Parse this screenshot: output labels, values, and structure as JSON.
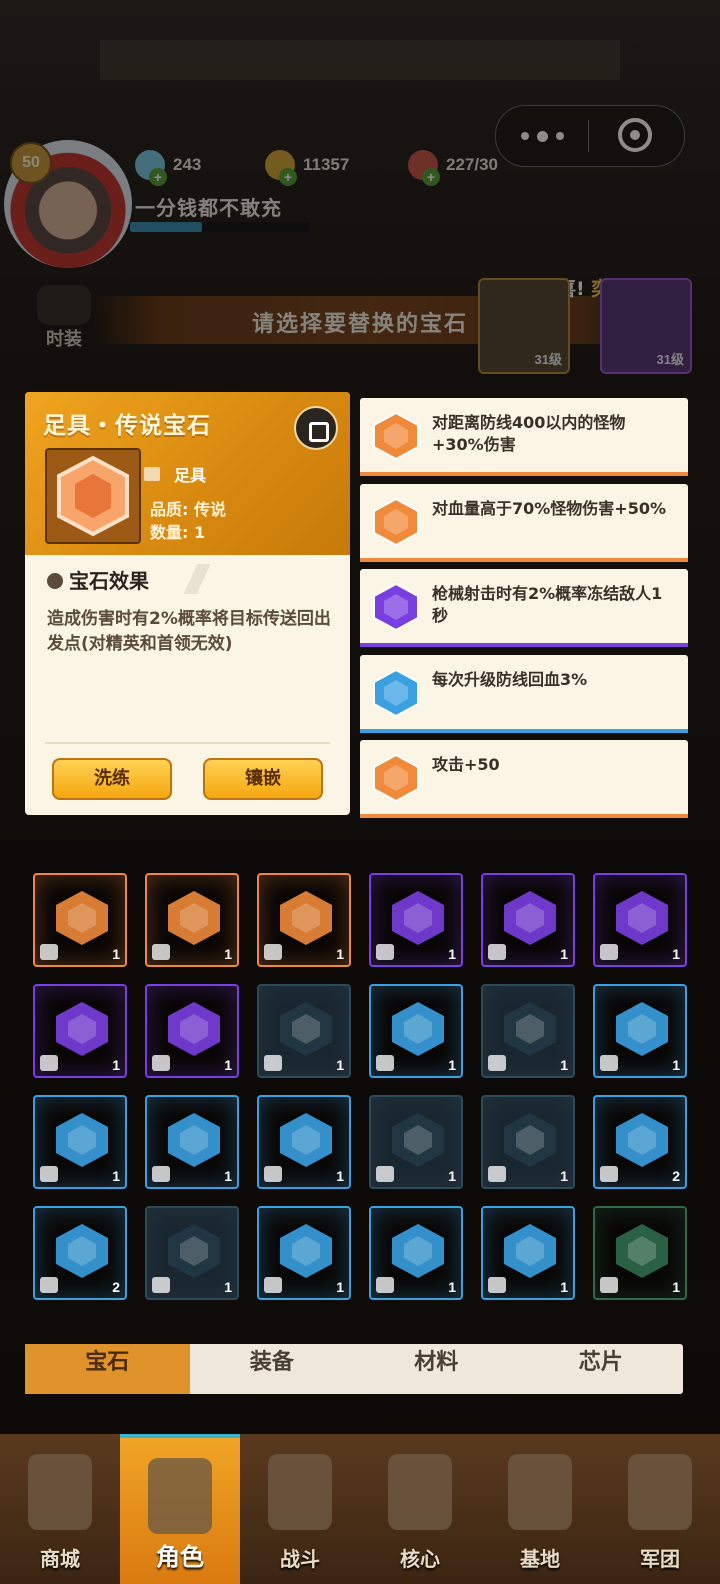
{
  "player": {
    "level": "50",
    "name": "一分钱都不敢充",
    "exp_fraction": 0.4
  },
  "resources": [
    {
      "icon": "diamond-icon",
      "value": "243",
      "color": "#7ec8e3"
    },
    {
      "icon": "gold-coin-icon",
      "value": "11357",
      "color": "#d4a83a"
    },
    {
      "icon": "meat-stamina-icon",
      "value": "227/30",
      "color": "#c9584b"
    }
  ],
  "side_menu": {
    "fashion_label": "时装"
  },
  "banner": {
    "title": "请选择要替换的宝石",
    "congrats": "恭喜!",
    "congrats_name": "奕"
  },
  "top_items": [
    {
      "level": "31级"
    },
    {
      "level": "31级"
    }
  ],
  "detail": {
    "title": "足具・传说宝石",
    "slot_label": "足具",
    "quality": "品质: 传说",
    "count": "数量: 1",
    "effect_heading": "宝石效果",
    "effect_text": "造成伤害时有2%概率将目标传送回出发点(对精英和首领无效)",
    "refine_button": "洗练",
    "inlay_button": "镶嵌"
  },
  "options": [
    {
      "text": "对距离防线400以内的怪物+30%伤害",
      "rarity": "orange"
    },
    {
      "text": "对血量高于70%怪物伤害+50%",
      "rarity": "orange"
    },
    {
      "text": "枪械射击时有2%概率冻结敌人1秒",
      "rarity": "purple"
    },
    {
      "text": "每次升级防线回血3%",
      "rarity": "blue"
    },
    {
      "text": "攻击+50",
      "rarity": "orange"
    }
  ],
  "colors": {
    "orange": "#f08a3a",
    "purple": "#7a3fe0",
    "blue": "#3aa0e0",
    "dark": "#2b4a5a",
    "green": "#2f6a4a"
  },
  "inventory": [
    {
      "rarity": "orange",
      "slot": "boots-icon",
      "count": "1"
    },
    {
      "rarity": "orange",
      "slot": "glove-icon",
      "count": "1"
    },
    {
      "rarity": "orange",
      "slot": "pants-icon",
      "count": "1"
    },
    {
      "rarity": "purple",
      "slot": "armor-icon",
      "count": "1"
    },
    {
      "rarity": "purple",
      "slot": "glove-icon",
      "count": "1"
    },
    {
      "rarity": "purple",
      "slot": "glove-icon",
      "count": "1"
    },
    {
      "rarity": "purple",
      "slot": "glove-icon",
      "count": "1"
    },
    {
      "rarity": "purple",
      "slot": "glove-icon",
      "count": "1"
    },
    {
      "rarity": "dark",
      "slot": "helmet-icon",
      "count": "1"
    },
    {
      "rarity": "blue",
      "slot": "armor-icon",
      "count": "1"
    },
    {
      "rarity": "dark",
      "slot": "armor-icon",
      "count": "1"
    },
    {
      "rarity": "blue",
      "slot": "armor-icon",
      "count": "1"
    },
    {
      "rarity": "blue",
      "slot": "armor-icon",
      "count": "1"
    },
    {
      "rarity": "blue",
      "slot": "boots-icon",
      "count": "1"
    },
    {
      "rarity": "blue",
      "slot": "boots-icon",
      "count": "1"
    },
    {
      "rarity": "dark",
      "slot": "glove-icon",
      "count": "1"
    },
    {
      "rarity": "dark",
      "slot": "glove-icon",
      "count": "1"
    },
    {
      "rarity": "blue",
      "slot": "pants-icon",
      "count": "2"
    },
    {
      "rarity": "blue",
      "slot": "pants-icon",
      "count": "2"
    },
    {
      "rarity": "dark",
      "slot": "glove-icon",
      "count": "1"
    },
    {
      "rarity": "blue",
      "slot": "glove-icon",
      "count": "1"
    },
    {
      "rarity": "blue",
      "slot": "glove-icon",
      "count": "1"
    },
    {
      "rarity": "blue",
      "slot": "glove-icon",
      "count": "1"
    },
    {
      "rarity": "green",
      "slot": "helmet-icon",
      "count": "1"
    }
  ],
  "tabs": [
    {
      "label": "宝石",
      "active": true
    },
    {
      "label": "装备",
      "active": false
    },
    {
      "label": "材料",
      "active": false
    },
    {
      "label": "芯片",
      "active": false
    }
  ],
  "nav": [
    {
      "label": "商城",
      "icon": "shop-icon",
      "active": false
    },
    {
      "label": "角色",
      "icon": "character-icon",
      "active": true
    },
    {
      "label": "战斗",
      "icon": "battle-icon",
      "active": false
    },
    {
      "label": "核心",
      "icon": "core-icon",
      "active": false
    },
    {
      "label": "基地",
      "icon": "base-icon",
      "active": false
    },
    {
      "label": "军团",
      "icon": "legion-icon",
      "active": false
    }
  ]
}
